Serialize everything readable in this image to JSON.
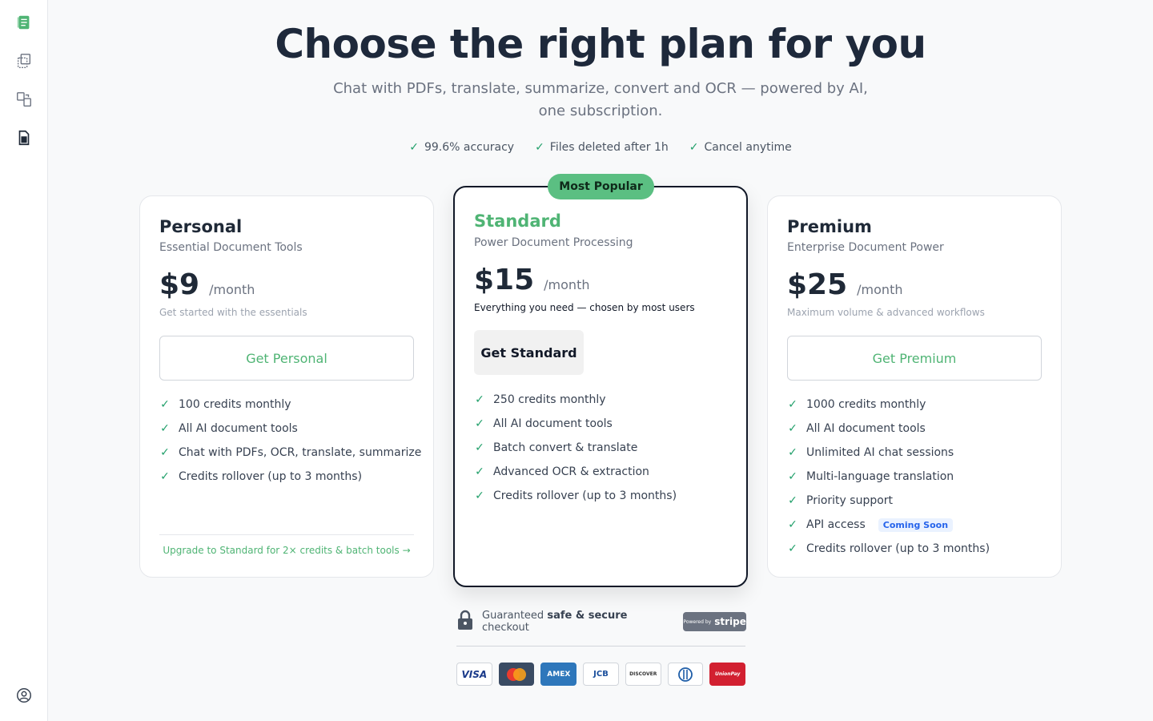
{
  "colors": {
    "accent": "#4fb474",
    "badge": "#5bbf82",
    "check": "#22a06b"
  },
  "sidebar": {
    "icons": [
      "document-stack-icon",
      "copy-icon",
      "convert-icon",
      "file-calculator-icon"
    ],
    "bottom_icon": "user-circle-icon"
  },
  "header": {
    "title": "Choose the right plan for you",
    "subtitle": "Chat with PDFs, translate, summarize, convert and OCR — powered by AI, one subscription.",
    "trust": [
      "99.6% accuracy",
      "Files deleted after 1h",
      "Cancel anytime"
    ]
  },
  "plans": {
    "personal": {
      "name": "Personal",
      "tagline": "Essential Document Tools",
      "price": "$9",
      "period": "/month",
      "note": "Get started with the essentials",
      "cta": "Get Personal",
      "features": [
        "100 credits monthly",
        "All AI document tools",
        "Chat with PDFs, OCR, translate, summarize",
        "Credits rollover (up to 3 months)"
      ],
      "upgrade": "Upgrade to Standard for 2× credits & batch tools →"
    },
    "standard": {
      "badge": "Most Popular",
      "name": "Standard",
      "tagline": "Power Document Processing",
      "price": "$15",
      "period": "/month",
      "note": "Everything you need — chosen by most users",
      "cta": "Get Standard",
      "features": [
        "250 credits monthly",
        "All AI document tools",
        "Batch convert & translate",
        "Advanced OCR & extraction",
        "Credits rollover (up to 3 months)"
      ]
    },
    "premium": {
      "name": "Premium",
      "tagline": "Enterprise Document Power",
      "price": "$25",
      "period": "/month",
      "note": "Maximum volume & advanced workflows",
      "cta": "Get Premium",
      "features": [
        "1000 credits monthly",
        "All AI document tools",
        "Unlimited AI chat sessions",
        "Multi-language translation",
        "Priority support",
        "API access",
        "Credits rollover (up to 3 months)"
      ],
      "coming_soon": "Coming Soon"
    }
  },
  "checkout": {
    "text_prefix": "Guaranteed",
    "text_bold": "safe & secure",
    "text_suffix": "checkout",
    "stripe_prefix": "Powered by",
    "stripe_name": "stripe",
    "payments": [
      "VISA",
      "",
      "AMEX",
      "JCB",
      "DISCOVER",
      "",
      "UnionPay"
    ]
  }
}
